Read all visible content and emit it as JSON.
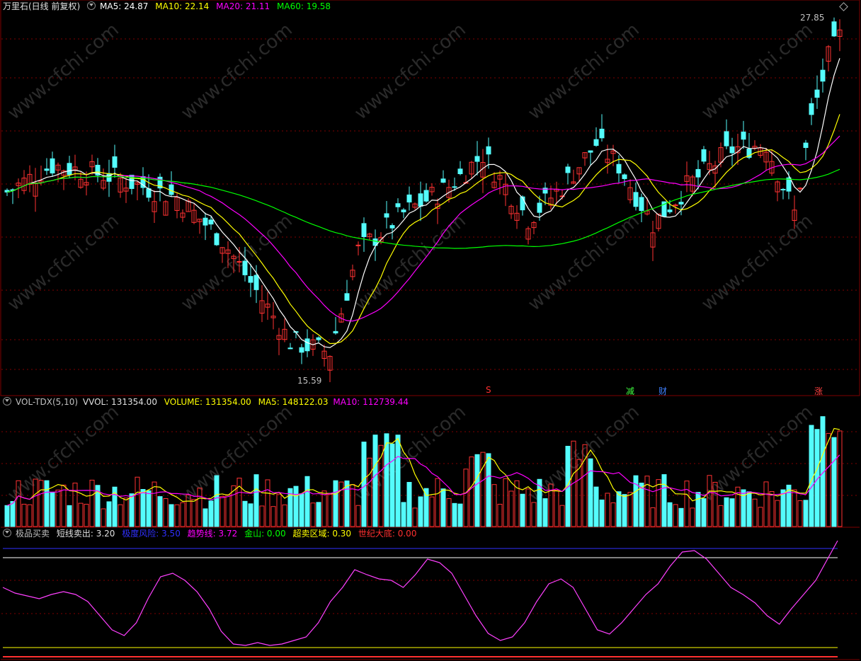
{
  "main": {
    "stock_name": "万里石(日线 前复权)",
    "ma5": "MA5: 24.87",
    "ma10": "MA10: 22.14",
    "ma20": "MA20: 21.11",
    "ma60": "MA60: 19.58",
    "high_label": "27.85",
    "low_label": "15.59",
    "signals": [
      {
        "text": "S",
        "color": "#ff3030"
      },
      {
        "text": "减",
        "color": "#40ff40"
      },
      {
        "text": "财",
        "color": "#4080ff"
      },
      {
        "text": "涨",
        "color": "#ff4040"
      }
    ]
  },
  "volume": {
    "indicator": "VOL-TDX(5,10)",
    "vvol": "VVOL: 131354.00",
    "volume": "VOLUME: 131354.00",
    "ma5": "MA5: 148122.03",
    "ma10": "MA10: 112739.44"
  },
  "osc": {
    "indicator": "极品买卖",
    "short_sell": "短线卖出: 3.20",
    "extreme_risk": "极度风险: 3.50",
    "trend": "趋势线: 3.72",
    "gold": "金山: 0.00",
    "oversold": "超卖区域: 0.30",
    "century_bottom": "世纪大底: 0.00"
  },
  "watermark": "www.cfchi.com",
  "colors": {
    "up": "#ff3232",
    "down": "#54fcfc",
    "ma5": "#ffffff",
    "ma10": "#ffff00",
    "ma20": "#ff00ff",
    "ma60": "#00ff00",
    "grid": "#800000",
    "volma5": "#ffff00",
    "volma10": "#ff00ff"
  }
}
